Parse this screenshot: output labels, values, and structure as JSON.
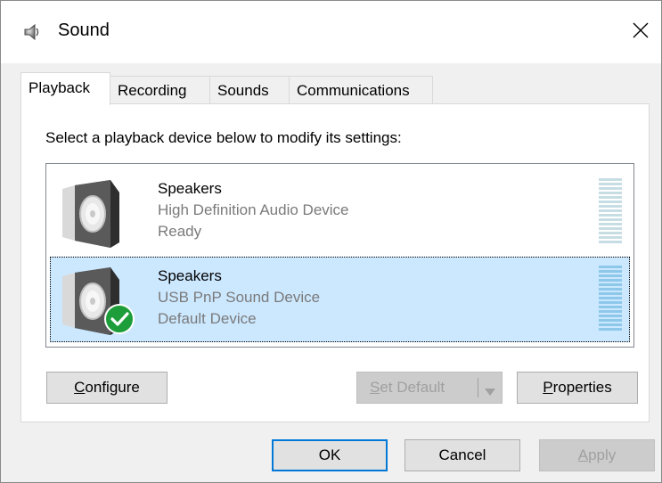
{
  "window": {
    "title": "Sound",
    "title_icon": "speaker-icon",
    "close_icon": "close-icon"
  },
  "tabs": [
    {
      "label": "Playback",
      "active": true
    },
    {
      "label": "Recording",
      "active": false
    },
    {
      "label": "Sounds",
      "active": false
    },
    {
      "label": "Communications",
      "active": false
    }
  ],
  "panel": {
    "instructions": "Select a playback device below to modify its settings:",
    "devices": [
      {
        "name": "Speakers",
        "description": "High Definition Audio Device",
        "status": "Ready",
        "icon": "speaker-device-icon",
        "selected": false,
        "is_default": false
      },
      {
        "name": "Speakers",
        "description": "USB PnP Sound Device",
        "status": "Default Device",
        "icon": "speaker-device-icon",
        "badge_icon": "default-check-icon",
        "selected": true,
        "is_default": true
      }
    ],
    "buttons": {
      "configure": {
        "mnemonic": "C",
        "rest": "onfigure",
        "enabled": true
      },
      "set_default": {
        "mnemonic": "S",
        "rest": "et Default",
        "enabled": false,
        "arrow_icon": "dropdown-arrow-icon"
      },
      "properties": {
        "mnemonic": "P",
        "rest": "roperties",
        "enabled": true
      }
    }
  },
  "footer": {
    "ok": "OK",
    "cancel": "Cancel",
    "apply": {
      "mnemonic": "A",
      "rest": "pply",
      "enabled": false
    }
  },
  "colors": {
    "accent": "#0078d7",
    "selection": "#cce8ff",
    "default_badge": "#1e9e3a",
    "disabled_text": "#a0a0a0"
  }
}
